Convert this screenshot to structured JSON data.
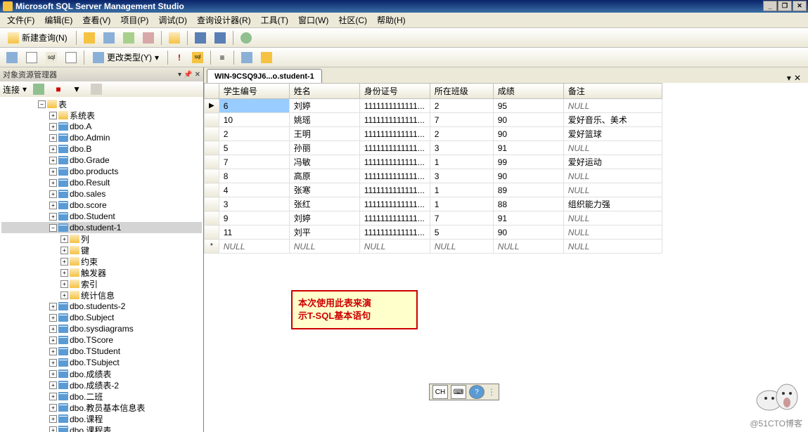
{
  "title_bar": {
    "title": "Microsoft SQL Server Management Studio"
  },
  "menu_bar": {
    "items": [
      "文件(F)",
      "编辑(E)",
      "查看(V)",
      "项目(P)",
      "调试(D)",
      "查询设计器(R)",
      "工具(T)",
      "窗口(W)",
      "社区(C)",
      "帮助(H)"
    ]
  },
  "toolbar1": {
    "new_query": "新建查询(N)"
  },
  "toolbar2": {
    "change_type": "更改类型(Y)"
  },
  "object_explorer": {
    "title": "对象资源管理器",
    "connect_label": "连接",
    "root": "表",
    "system_tables": "系统表",
    "tables": [
      "dbo.A",
      "dbo.Admin",
      "dbo.B",
      "dbo.Grade",
      "dbo.products",
      "dbo.Result",
      "dbo.sales",
      "dbo.score",
      "dbo.Student"
    ],
    "selected_table": "dbo.student-1",
    "sub_folders": [
      "列",
      "键",
      "约束",
      "触发器",
      "索引",
      "统计信息"
    ],
    "tables2": [
      "dbo.students-2",
      "dbo.Subject",
      "dbo.sysdiagrams",
      "dbo.TScore",
      "dbo.TStudent",
      "dbo.TSubject",
      "dbo.成绩表",
      "dbo.成绩表-2",
      "dbo.二班",
      "dbo.教员基本信息表",
      "dbo.课程",
      "dbo.课程表"
    ]
  },
  "tab": {
    "title": "WIN-9CSQ9J6...o.student-1"
  },
  "grid": {
    "columns": [
      "学生编号",
      "姓名",
      "身份证号",
      "所在班级",
      "成绩",
      "备注"
    ],
    "rows": [
      {
        "id": "6",
        "name": "刘婷",
        "idcard": "1111111111111...",
        "class": "2",
        "score": "95",
        "remark": "NULL",
        "indicator": "▶"
      },
      {
        "id": "10",
        "name": "姚瑶",
        "idcard": "1111111111111...",
        "class": "7",
        "score": "90",
        "remark": "爱好音乐、美术",
        "indicator": ""
      },
      {
        "id": "2",
        "name": "王明",
        "idcard": "1111111111111...",
        "class": "2",
        "score": "90",
        "remark": "爱好篮球",
        "indicator": ""
      },
      {
        "id": "5",
        "name": "孙丽",
        "idcard": "1111111111111...",
        "class": "3",
        "score": "91",
        "remark": "NULL",
        "indicator": ""
      },
      {
        "id": "7",
        "name": "冯敏",
        "idcard": "1111111111111...",
        "class": "1",
        "score": "99",
        "remark": "爱好运动",
        "indicator": ""
      },
      {
        "id": "8",
        "name": "高原",
        "idcard": "1111111111111...",
        "class": "3",
        "score": "90",
        "remark": "NULL",
        "indicator": ""
      },
      {
        "id": "4",
        "name": "张寒",
        "idcard": "1111111111111...",
        "class": "1",
        "score": "89",
        "remark": "NULL",
        "indicator": ""
      },
      {
        "id": "3",
        "name": "张红",
        "idcard": "1111111111111...",
        "class": "1",
        "score": "88",
        "remark": "组织能力强",
        "indicator": ""
      },
      {
        "id": "9",
        "name": "刘婷",
        "idcard": "1111111111111...",
        "class": "7",
        "score": "91",
        "remark": "NULL",
        "indicator": ""
      },
      {
        "id": "11",
        "name": "刘平",
        "idcard": "1111111111111...",
        "class": "5",
        "score": "90",
        "remark": "NULL",
        "indicator": ""
      }
    ],
    "null_row_indicator": "*",
    "null_text": "NULL"
  },
  "annotation": {
    "line1": "本次使用此表来演",
    "line2": "示T-SQL基本语句"
  },
  "ime": {
    "label": "CH"
  },
  "watermark": "@51CTO博客"
}
